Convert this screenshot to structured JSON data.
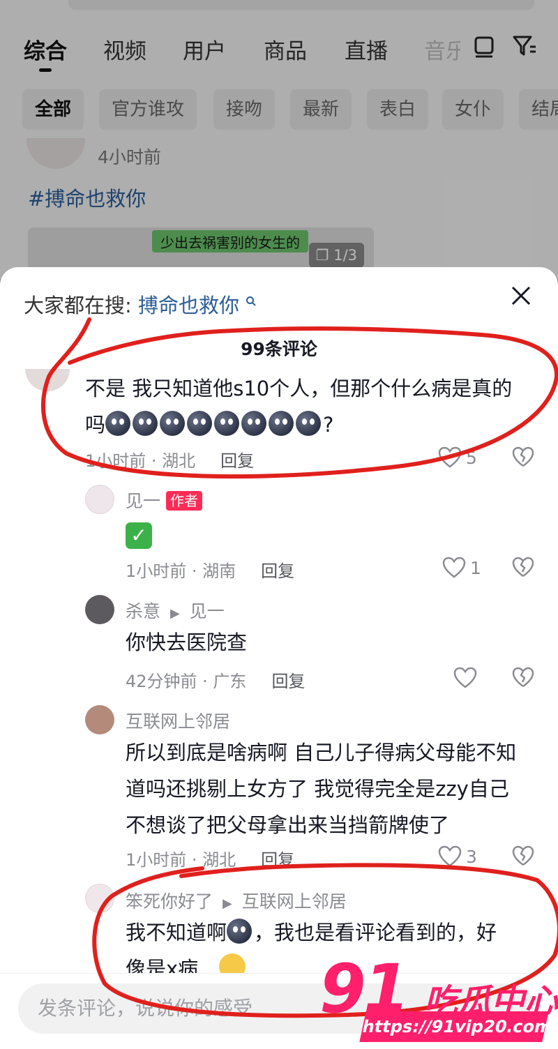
{
  "search_page": {
    "tabs": [
      {
        "label": "综合",
        "active": true
      },
      {
        "label": "视频",
        "active": false
      },
      {
        "label": "用户",
        "active": false
      },
      {
        "label": "商品",
        "active": false
      },
      {
        "label": "直播",
        "active": false
      },
      {
        "label": "音乐",
        "active": false
      }
    ],
    "chips": [
      {
        "label": "全部",
        "active": true
      },
      {
        "label": "官方谁攻",
        "active": false
      },
      {
        "label": "接吻",
        "active": false
      },
      {
        "label": "最新",
        "active": false
      },
      {
        "label": "表白",
        "active": false
      },
      {
        "label": "女仆",
        "active": false
      },
      {
        "label": "结局",
        "active": false
      }
    ],
    "post": {
      "time": "4小时前",
      "hashtag": "#搏命也救你",
      "chat_snippet": "少出去祸害别的女生的",
      "image_count": "1/3"
    }
  },
  "sheet": {
    "hot_search_label": "大家都在搜:",
    "hot_search_keyword": "搏命也救你",
    "comment_count": "99条评论"
  },
  "comments": [
    {
      "text_line1": "不是 我只知道他s10个人，但那个什么病是真的",
      "text_line2_prefix": "吗",
      "text_line2_suffix": "?",
      "meta": "1小时前 · 湖北",
      "reply": "回复",
      "likes": "5"
    },
    {
      "name": "见一",
      "badge": "作者",
      "emoji": "✓",
      "meta": "1小时前 · 湖南",
      "reply": "回复",
      "likes": "1"
    },
    {
      "name": "杀意",
      "reply_to": "见一",
      "text": "你快去医院查",
      "meta": "42分钟前 · 广东",
      "reply": "回复"
    },
    {
      "name": "互联网上邻居",
      "text_lines": [
        "所以到底是啥病啊 自己儿子得病父母能不知",
        "道吗还挑剔上女方了 我觉得完全是zzy自己",
        "不想谈了把父母拿出来当挡箭牌使了"
      ],
      "meta": "1小时前 · 湖北",
      "reply": "回复",
      "likes": "3"
    },
    {
      "name": "笨死你好了",
      "reply_to": "互联网上邻居",
      "text_line1_prefix": "我不知道啊",
      "text_line1_suffix": "，我也是看评论看到的，好",
      "text_line2": "像是x病"
    }
  ],
  "input": {
    "placeholder": "发条评论，说说你的感受"
  },
  "watermark": {
    "number": "91",
    "text": "吃瓜中心",
    "url": "https://91vip20.com"
  },
  "colors": {
    "accent_red": "#fe2c55",
    "link_blue": "#2b5d96",
    "annotation_red": "#e0201c",
    "watermark_pink": "#ff1f6b"
  }
}
